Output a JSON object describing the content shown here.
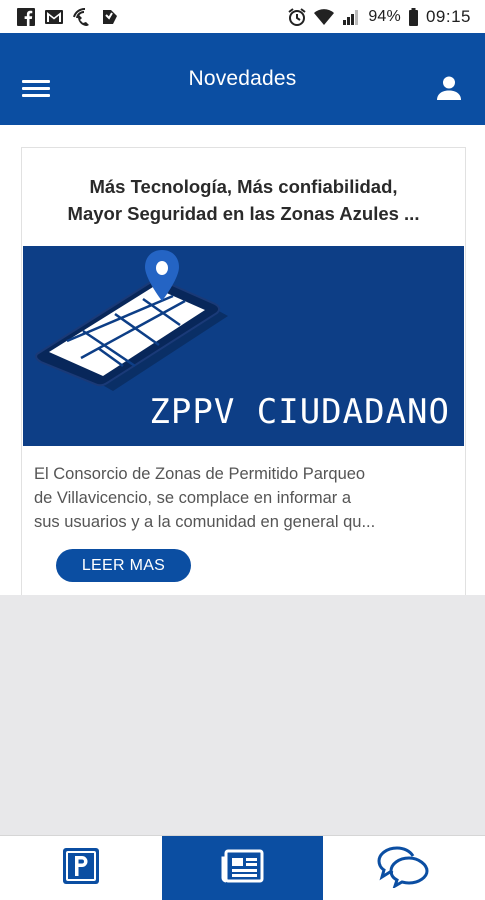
{
  "status_bar": {
    "left_icons": [
      "facebook-icon",
      "gmail-icon",
      "wifi-calling-icon",
      "nfc-icon"
    ],
    "battery_percent": "94%",
    "time": "09:15"
  },
  "app_bar": {
    "title": "Novedades",
    "menu_icon": "menu-icon",
    "profile_icon": "user-icon"
  },
  "news": [
    {
      "title_lines": [
        "Más Tecnología, Más confiabilidad,",
        "Mayor Seguridad en las Zonas Azules ..."
      ],
      "image_caption": "ZPPV CIUDADANO",
      "excerpt_lines": [
        "El Consorcio de Zonas de Permitido Parqueo",
        "de Villavicencio, se complace en informar a",
        "sus usuarios y a la comunidad en general qu..."
      ],
      "button_label": "LEER MAS"
    }
  ],
  "bottom_nav": {
    "items": [
      {
        "icon": "parking-icon",
        "active": false
      },
      {
        "icon": "news-icon",
        "active": true
      },
      {
        "icon": "chat-icon",
        "active": false
      }
    ]
  },
  "colors": {
    "primary": "#0b4ea2",
    "image_background": "#0d3e86",
    "content_background": "#e8e8ea"
  }
}
